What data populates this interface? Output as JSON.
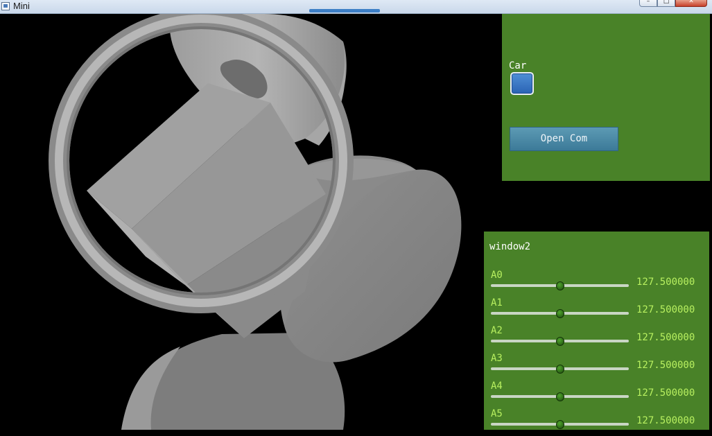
{
  "window": {
    "title": "Mini",
    "minimize": "–",
    "maximize": "□",
    "close": "✕"
  },
  "panel_car": {
    "checkbox_label": "Car",
    "checkbox_checked": false,
    "button_label": "Open Com"
  },
  "panel_window2": {
    "title": "window2",
    "sliders": [
      {
        "label": "A0",
        "value": "127.500000",
        "level": 0.5
      },
      {
        "label": "A1",
        "value": "127.500000",
        "level": 0.5
      },
      {
        "label": "A2",
        "value": "127.500000",
        "level": 0.5
      },
      {
        "label": "A3",
        "value": "127.500000",
        "level": 0.5
      },
      {
        "label": "A4",
        "value": "127.500000",
        "level": 0.5
      },
      {
        "label": "A5",
        "value": "127.500000",
        "level": 0.5
      }
    ]
  },
  "colors": {
    "panel_bg": "#498228",
    "slider_text": "#b8f060",
    "button_bg": "#4a89a6",
    "viewport_bg": "#000000"
  }
}
